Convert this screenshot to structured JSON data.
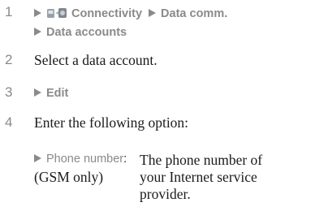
{
  "steps": [
    {
      "num": "1",
      "line1": {
        "item1": "Connectivity",
        "item2": "Data comm."
      },
      "line2": {
        "item": "Data accounts"
      }
    },
    {
      "num": "2",
      "text": "Select a data account."
    },
    {
      "num": "3",
      "item": "Edit"
    },
    {
      "num": "4",
      "text": "Enter the following option:"
    }
  ],
  "option": {
    "name": "Phone number",
    "colon": ":",
    "note": "(GSM only)",
    "desc_lines": [
      "The phone number of",
      "your Internet service",
      "provider."
    ]
  },
  "icons": {
    "arrow": "right-triangle-arrow-icon",
    "connectivity": "connectivity-icon"
  }
}
